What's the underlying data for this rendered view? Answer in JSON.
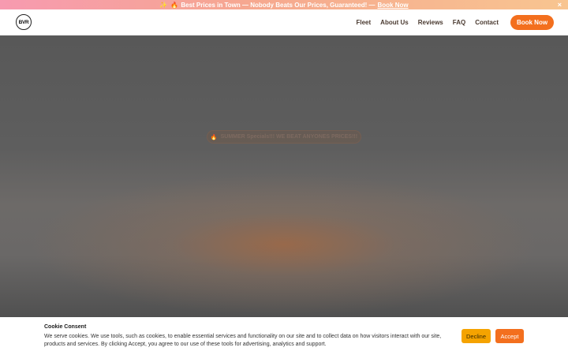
{
  "promo": {
    "sparkle_icon": "✨",
    "fire_icon": "🔥",
    "text": "Best Prices in Town — Nobody Beats Our Prices, Guaranteed! —",
    "link": "Book Now",
    "close": "×"
  },
  "nav": {
    "logo_text": "BVR",
    "links": [
      "Fleet",
      "About Us",
      "Reviews",
      "FAQ",
      "Contact"
    ],
    "cta": "Book Now"
  },
  "hero": {
    "badge_icon": "🔥",
    "badge_text": "SUMMER Specials!!! WE BEAT ANYONES PRICES!!!"
  },
  "cookie": {
    "title": "Cookie Consent",
    "text": "We serve cookies. We use tools, such as cookies, to enable essential services and functionality on our site and to collect data on how visitors interact with our site, products and services. By clicking Accept, you agree to our use of these tools for advertising, analytics and support.",
    "decline": "Decline",
    "accept": "Accept"
  },
  "colors": {
    "accent": "#f36f1e",
    "decline": "#f5a300"
  }
}
